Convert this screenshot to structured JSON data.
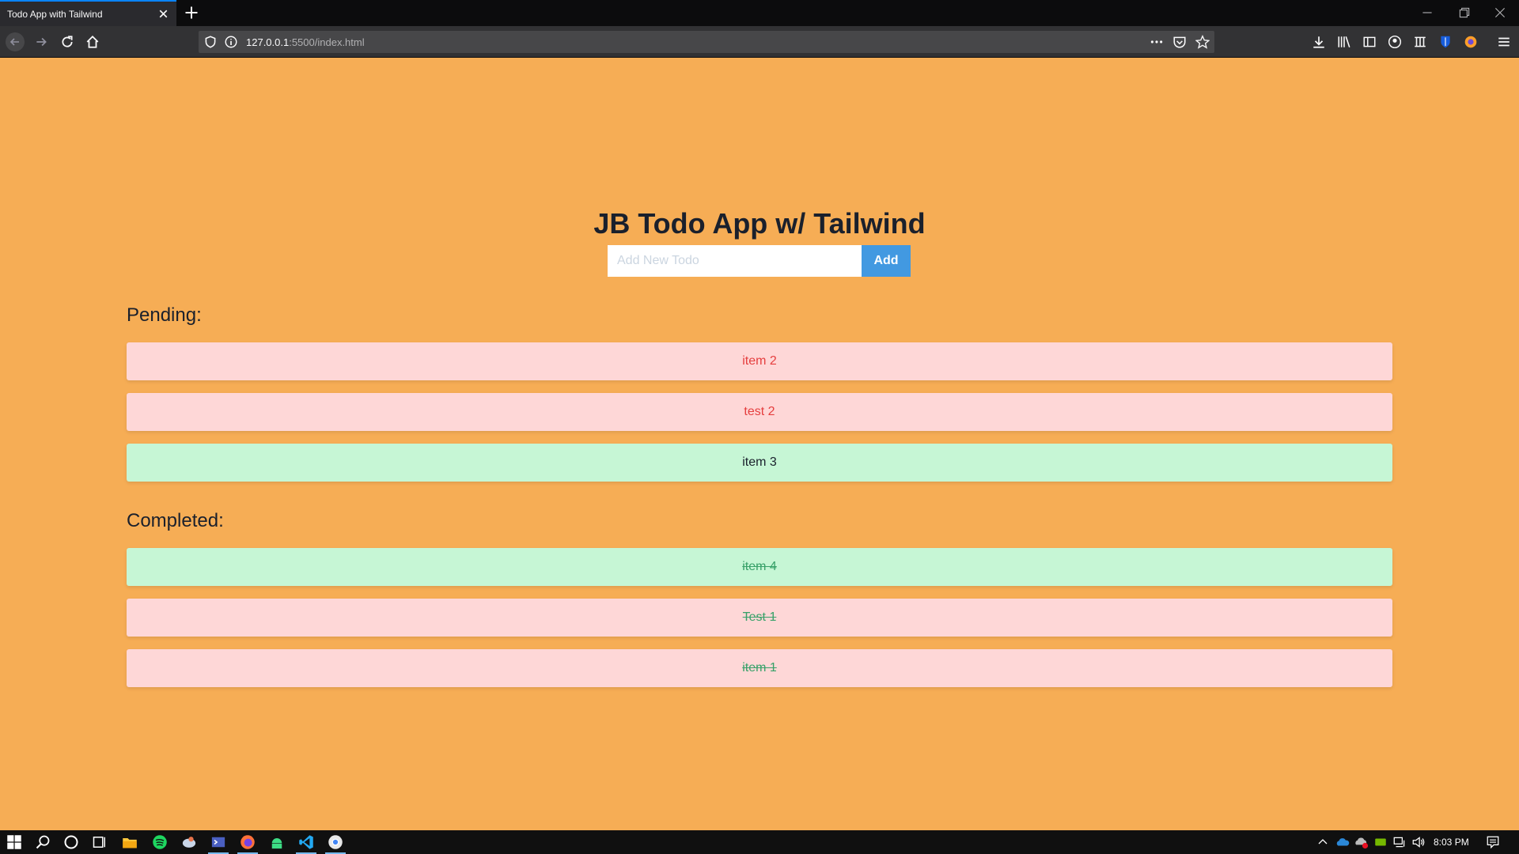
{
  "browser": {
    "tab": {
      "title": "Todo App with Tailwind"
    },
    "url": {
      "host": "127.0.0.1",
      "path": ":5500/index.html"
    }
  },
  "app": {
    "title": "JB Todo App w/ Tailwind",
    "input_placeholder": "Add New Todo",
    "add_label": "Add",
    "pending_label": "Pending:",
    "completed_label": "Completed:",
    "pending": [
      {
        "text": "item 2",
        "color": "red"
      },
      {
        "text": "test 2",
        "color": "red"
      },
      {
        "text": "item 3",
        "color": "green"
      }
    ],
    "completed": [
      {
        "text": "item 4",
        "color": "green"
      },
      {
        "text": "Test 1",
        "color": "red"
      },
      {
        "text": "item 1",
        "color": "red"
      }
    ]
  },
  "taskbar": {
    "clock": "8:03 PM"
  },
  "colors": {
    "page_bg": "#f6ad55",
    "accent_blue": "#4299e1",
    "item_red_bg": "#fed7d7",
    "item_green_bg": "#c6f6d5",
    "done_text": "#38a169",
    "pending_red_text": "#e53e3e"
  }
}
